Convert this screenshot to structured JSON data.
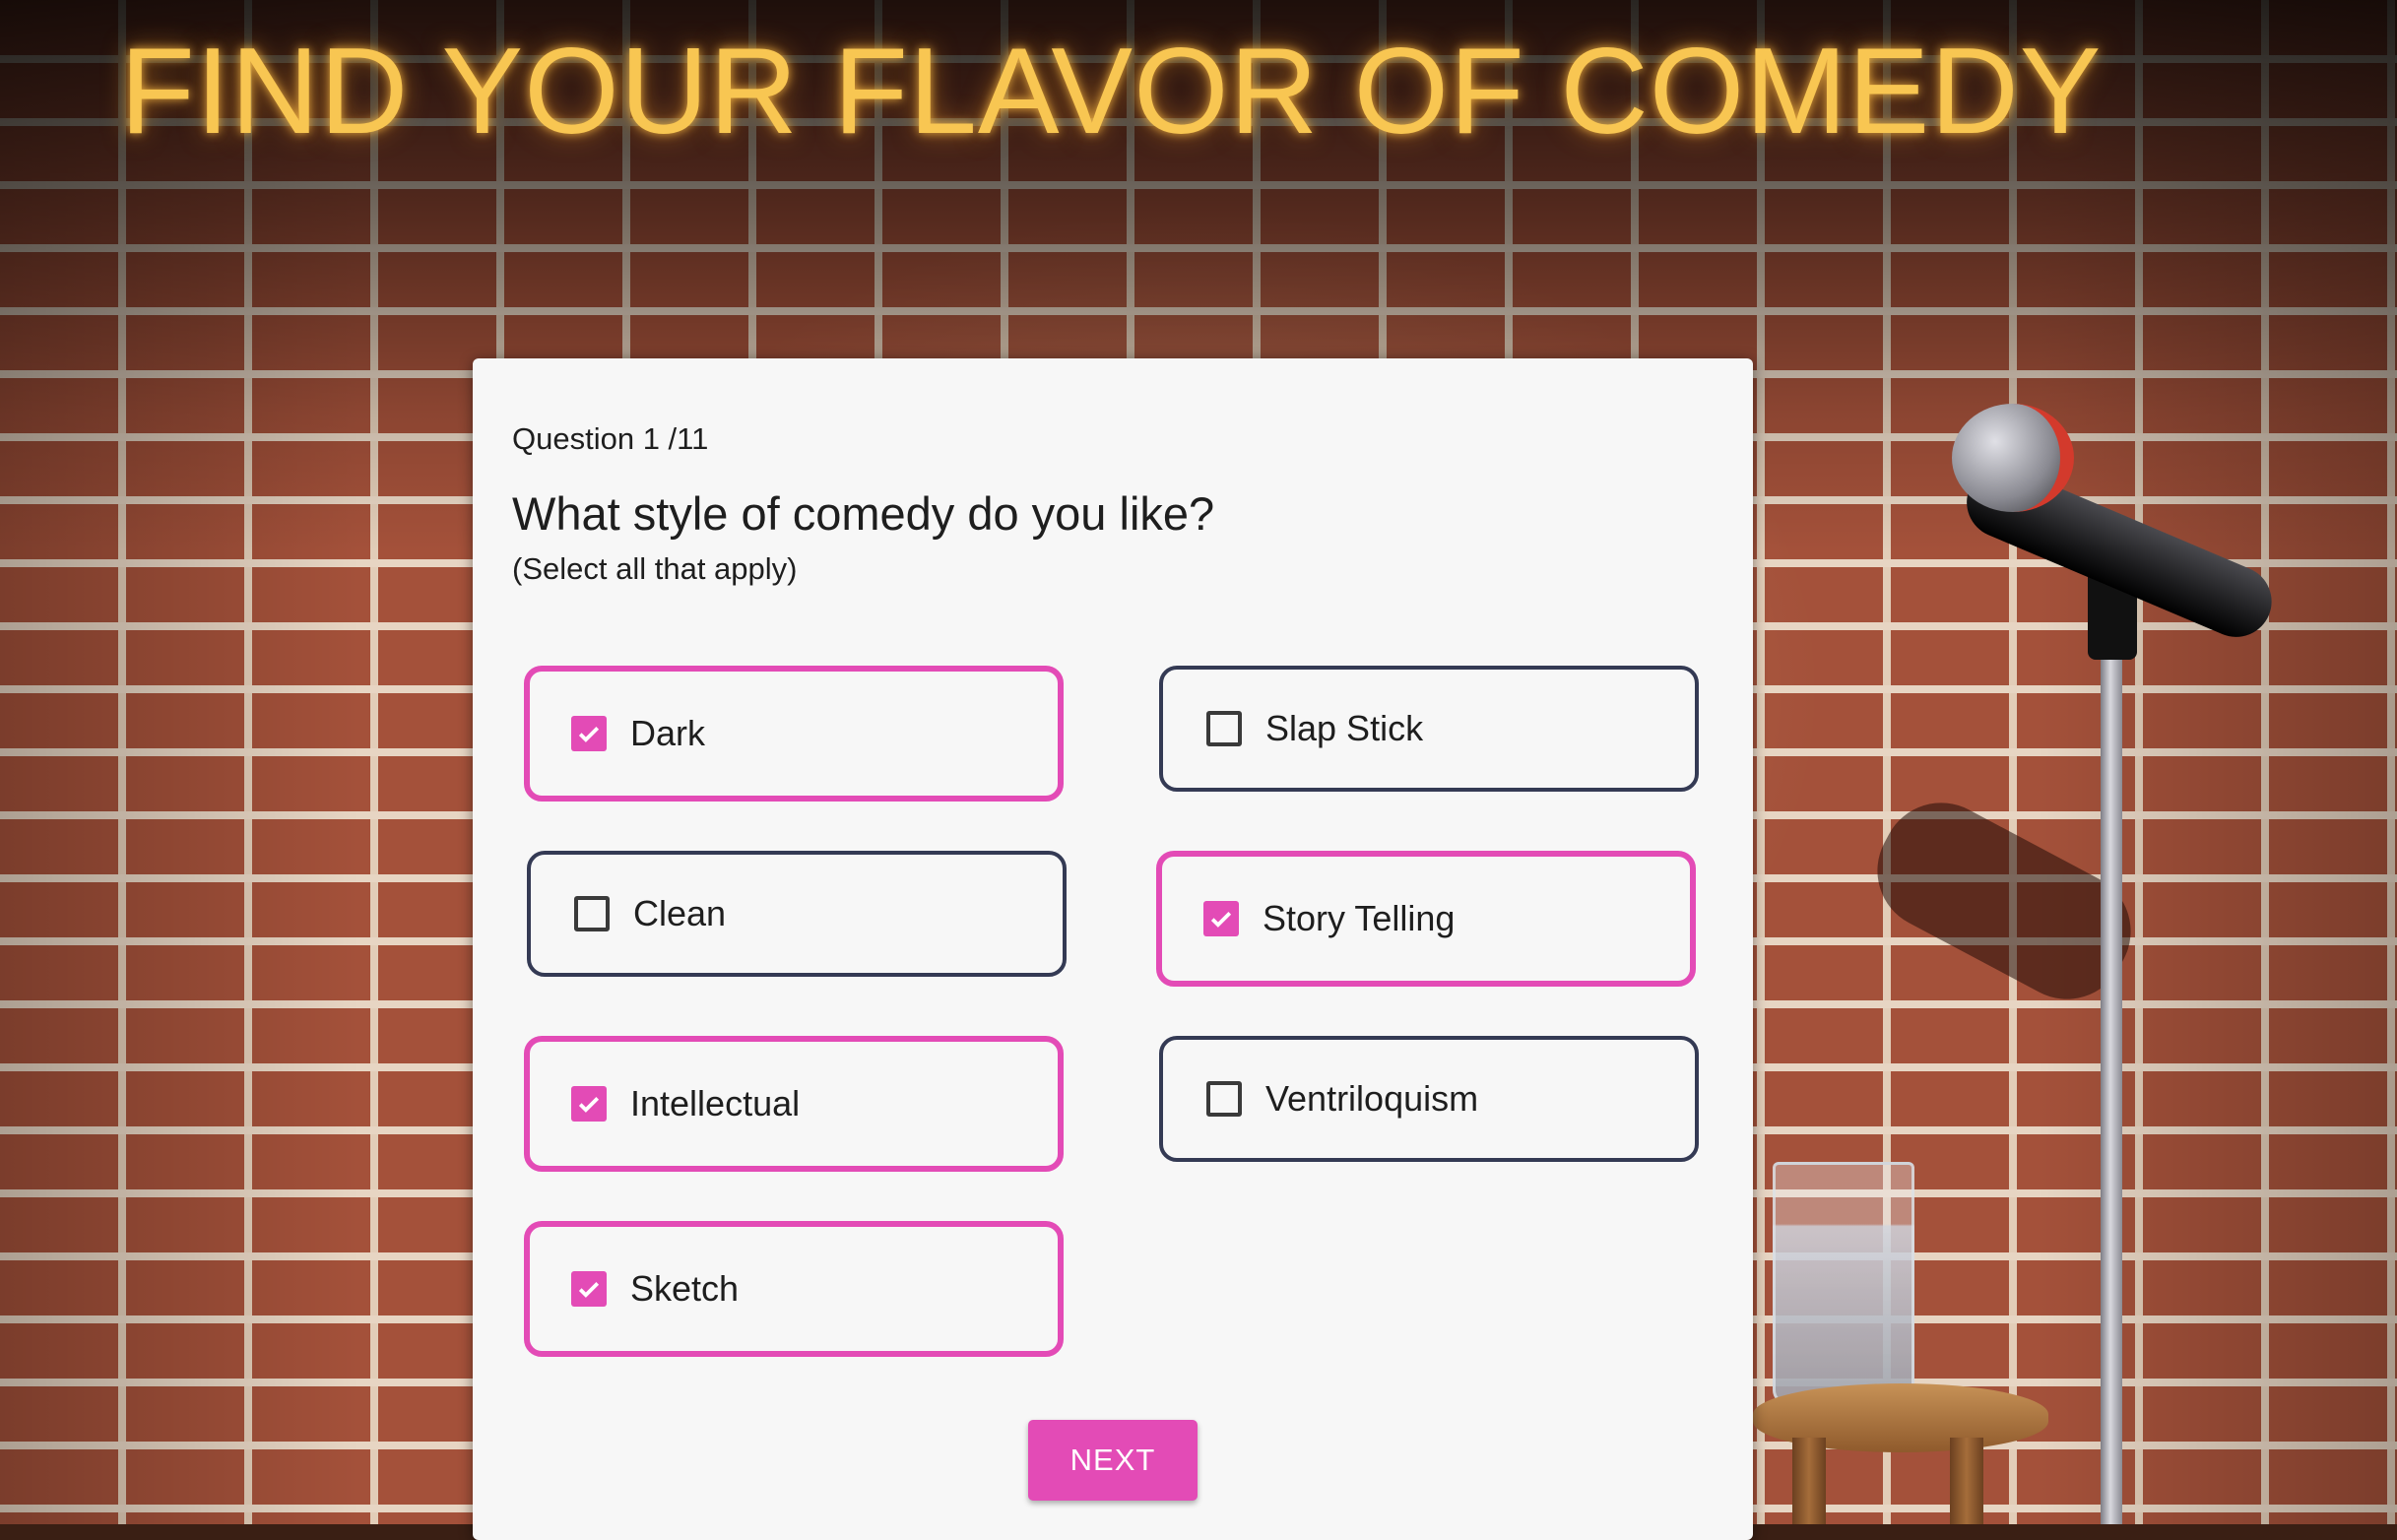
{
  "page": {
    "title": "FIND YOUR FLAVOR OF COMEDY"
  },
  "quiz": {
    "counter": "Question 1 /11",
    "question": "What style of comedy do you like?",
    "hint": "(Select all that apply)",
    "options": [
      {
        "label": "Dark",
        "checked": true
      },
      {
        "label": "Slap Stick",
        "checked": false
      },
      {
        "label": "Clean",
        "checked": false
      },
      {
        "label": "Story Telling",
        "checked": true
      },
      {
        "label": "Intellectual",
        "checked": true
      },
      {
        "label": "Ventriloquism",
        "checked": false
      },
      {
        "label": "Sketch",
        "checked": true
      }
    ],
    "next_label": "NEXT"
  },
  "colors": {
    "accent": "#e34bb6",
    "title": "#f8c652",
    "option_border": "#343a54",
    "card": "#f7f7f7"
  },
  "icons": {
    "checked": "checkmark-icon",
    "unchecked": "empty-checkbox-icon"
  }
}
